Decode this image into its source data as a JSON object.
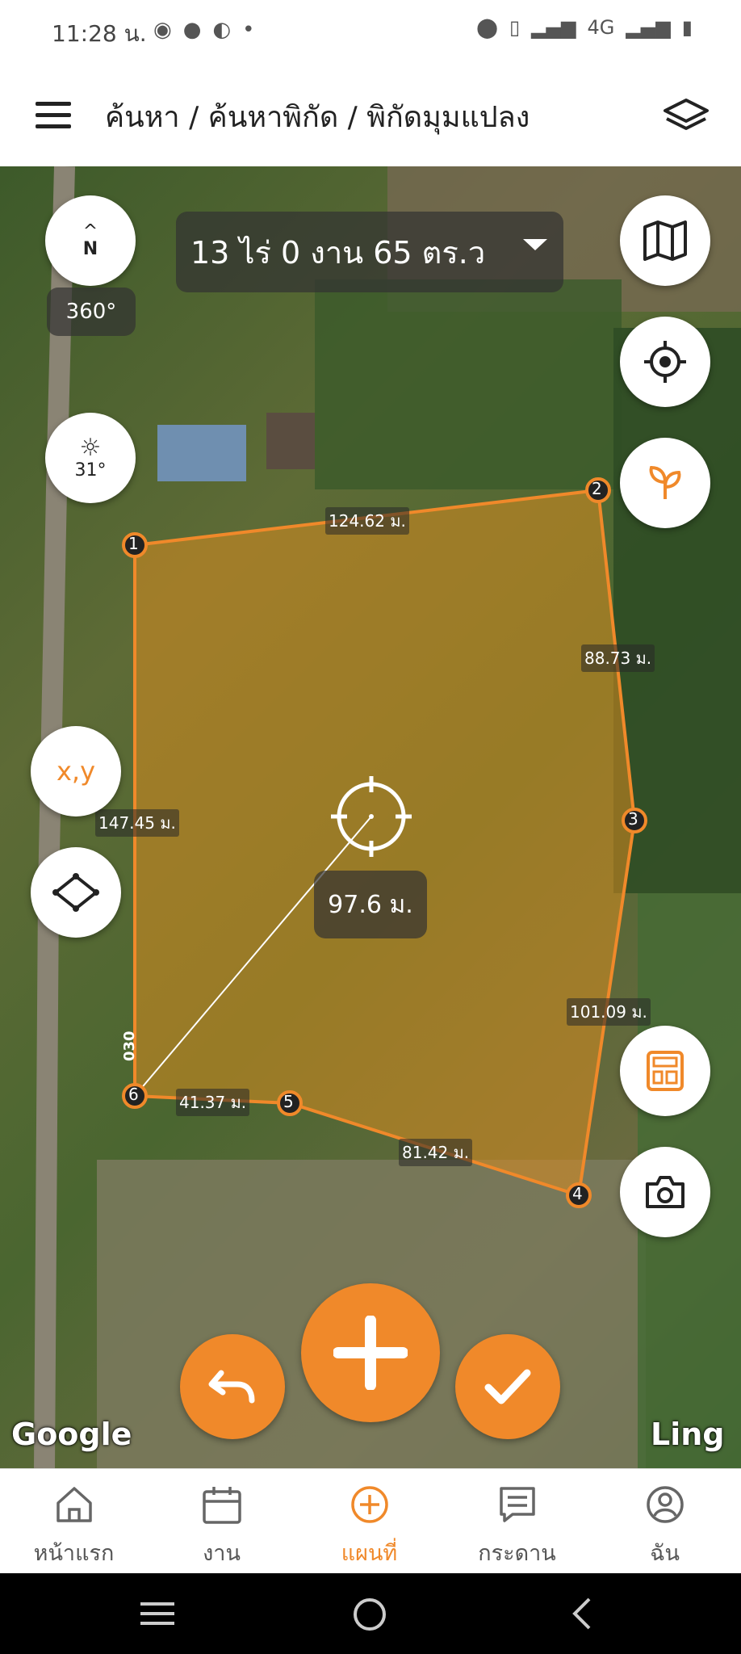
{
  "status_bar": {
    "time": "11:28 น.",
    "network": "4G"
  },
  "header": {
    "breadcrumb": "ค้นหา / ค้นหาพิกัด / พิกัดมุมแปลง"
  },
  "map": {
    "area_text": "13 ไร่ 0 งาน 65 ตร.ว",
    "compass_label": "N",
    "rotation": "360°",
    "brightness": "31°",
    "coord_button_label": "x,y",
    "distance_readout": "97.6 ม.",
    "side_text": "030",
    "edge_lengths": [
      "124.62 ม.",
      "88.73 ม.",
      "101.09 ม.",
      "81.42 ม.",
      "41.37 ม.",
      "147.45 ม."
    ],
    "vertices": [
      "1",
      "2",
      "3",
      "4",
      "5",
      "6"
    ],
    "watermark_left": "Google",
    "watermark_right": "Ling",
    "accent_color": "#f0892a"
  },
  "bottom_nav": {
    "items": [
      {
        "label": "หน้าแรก",
        "icon": "home-icon"
      },
      {
        "label": "งาน",
        "icon": "calendar-icon"
      },
      {
        "label": "แผนที่",
        "icon": "plus-circle-icon",
        "active": true
      },
      {
        "label": "กระดาน",
        "icon": "board-icon"
      },
      {
        "label": "ฉัน",
        "icon": "profile-icon"
      }
    ]
  }
}
